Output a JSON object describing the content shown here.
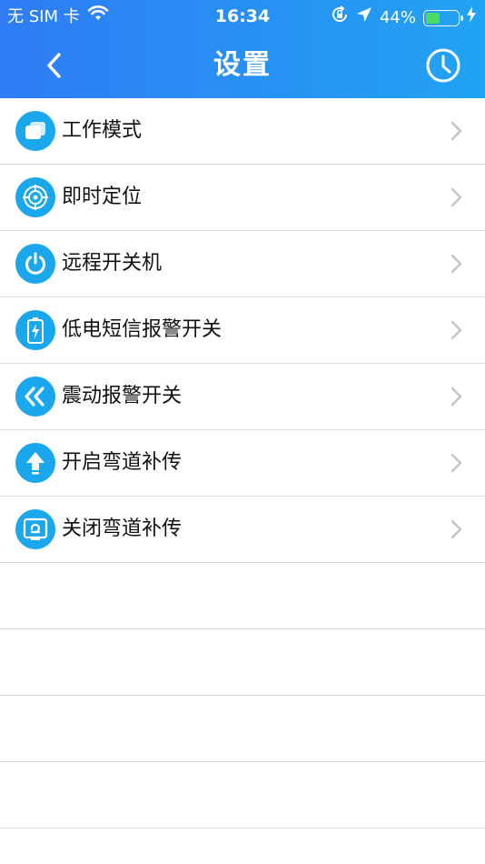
{
  "status_bar": {
    "carrier": "无 SIM 卡",
    "time": "16:34",
    "battery_percent": "44%",
    "battery_level": 0.44
  },
  "nav": {
    "title": "设置"
  },
  "settings": [
    {
      "label": "工作模式",
      "icon": "work-mode-icon"
    },
    {
      "label": "即时定位",
      "icon": "locate-icon"
    },
    {
      "label": "远程开关机",
      "icon": "power-icon"
    },
    {
      "label": "低电短信报警开关",
      "icon": "battery-icon"
    },
    {
      "label": "震动报警开关",
      "icon": "vibration-icon"
    },
    {
      "label": "开启弯道补传",
      "icon": "upload-icon"
    },
    {
      "label": "关闭弯道补传",
      "icon": "screen-icon"
    }
  ],
  "colors": {
    "header_gradient_start": "#2f7cf5",
    "header_gradient_end": "#22a3f3",
    "icon_bg": "#1aa7ec",
    "divider": "#dcdcdc",
    "battery_fill": "#4cd964"
  }
}
